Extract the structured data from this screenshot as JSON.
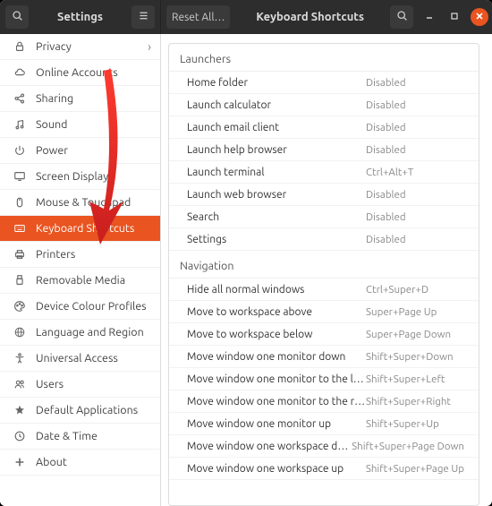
{
  "header": {
    "app_title": "Settings",
    "reset_label": "Reset All…",
    "page_title": "Keyboard Shortcuts"
  },
  "sidebar": {
    "items": [
      {
        "id": "privacy",
        "label": "Privacy",
        "chevron": true
      },
      {
        "id": "online-accounts",
        "label": "Online Accounts"
      },
      {
        "id": "sharing",
        "label": "Sharing"
      },
      {
        "id": "sound",
        "label": "Sound"
      },
      {
        "id": "power",
        "label": "Power"
      },
      {
        "id": "screen-display",
        "label": "Screen Display"
      },
      {
        "id": "mouse-touchpad",
        "label": "Mouse & Touchpad"
      },
      {
        "id": "keyboard-shortcuts",
        "label": "Keyboard Shortcuts",
        "selected": true
      },
      {
        "id": "printers",
        "label": "Printers"
      },
      {
        "id": "removable-media",
        "label": "Removable Media"
      },
      {
        "id": "colour",
        "label": "Device Colour Profiles"
      },
      {
        "id": "region",
        "label": "Language and Region"
      },
      {
        "id": "universal-access",
        "label": "Universal Access"
      },
      {
        "id": "users",
        "label": "Users"
      },
      {
        "id": "default-apps",
        "label": "Default Applications"
      },
      {
        "id": "date-time",
        "label": "Date & Time"
      },
      {
        "id": "about",
        "label": "About"
      }
    ]
  },
  "main": {
    "sections": [
      {
        "title": "Launchers",
        "rows": [
          {
            "name": "Home folder",
            "shortcut": "Disabled"
          },
          {
            "name": "Launch calculator",
            "shortcut": "Disabled"
          },
          {
            "name": "Launch email client",
            "shortcut": "Disabled"
          },
          {
            "name": "Launch help browser",
            "shortcut": "Disabled"
          },
          {
            "name": "Launch terminal",
            "shortcut": "Ctrl+Alt+T"
          },
          {
            "name": "Launch web browser",
            "shortcut": "Disabled"
          },
          {
            "name": "Search",
            "shortcut": "Disabled"
          },
          {
            "name": "Settings",
            "shortcut": "Disabled"
          }
        ]
      },
      {
        "title": "Navigation",
        "rows": [
          {
            "name": "Hide all normal windows",
            "shortcut": "Ctrl+Super+D"
          },
          {
            "name": "Move to workspace above",
            "shortcut": "Super+Page Up"
          },
          {
            "name": "Move to workspace below",
            "shortcut": "Super+Page Down"
          },
          {
            "name": "Move window one monitor down",
            "shortcut": "Shift+Super+Down"
          },
          {
            "name": "Move window one monitor to the left",
            "shortcut": "Shift+Super+Left"
          },
          {
            "name": "Move window one monitor to the right",
            "shortcut": "Shift+Super+Right"
          },
          {
            "name": "Move window one monitor up",
            "shortcut": "Shift+Super+Up"
          },
          {
            "name": "Move window one workspace down",
            "shortcut": "Shift+Super+Page Down"
          },
          {
            "name": "Move window one workspace up",
            "shortcut": "Shift+Super+Page Up"
          }
        ]
      }
    ]
  },
  "icons": {
    "privacy": "lock",
    "online-accounts": "cloud",
    "sharing": "share",
    "sound": "music",
    "power": "power",
    "screen-display": "display",
    "mouse-touchpad": "mouse",
    "keyboard-shortcuts": "keyboard",
    "printers": "printer",
    "removable-media": "usb",
    "colour": "palette",
    "region": "globe",
    "universal-access": "accessibility",
    "users": "users",
    "default-apps": "star",
    "date-time": "clock",
    "about": "plus"
  }
}
